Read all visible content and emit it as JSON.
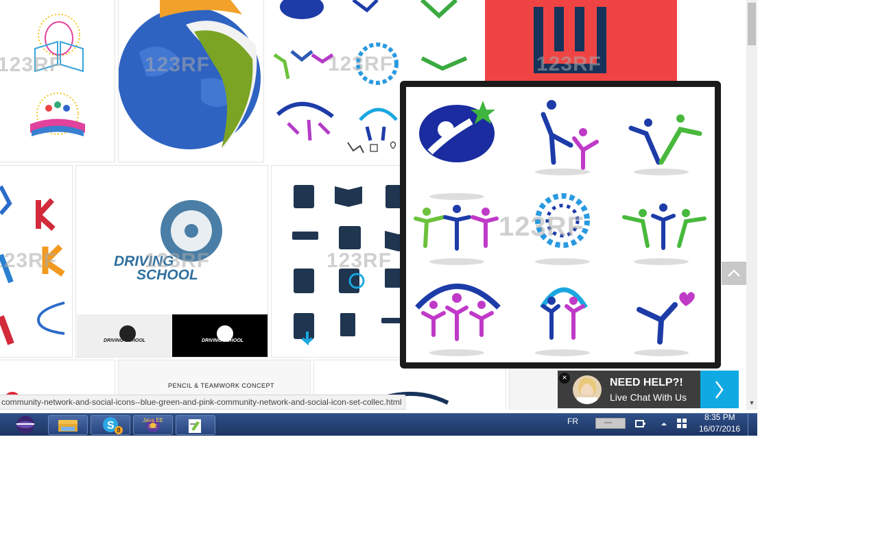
{
  "watermark": "123RF",
  "tiles": {
    "driving_school_title": "DRIVING",
    "driving_school_subtitle": "SCHOOL",
    "driving_school_small": "DRIVING SCHOOL",
    "pencil_concept": "PENCIL & TEAMWORK CONCEPT"
  },
  "popup": {
    "watermark": "123RF"
  },
  "chat": {
    "title": "NEED HELP?!",
    "subtitle": "Live Chat With Us",
    "close": "×"
  },
  "status_url": "community-network-and-social-icons--blue-green-and-pink-community-network-and-social-icon-set-collec.html",
  "taskbar": {
    "java_label": "Java EE IDE",
    "skype_badge": "8",
    "language": "FR",
    "battery_text": "---",
    "time": "8:35 PM",
    "date": "16/07/2016"
  },
  "colors": {
    "accent_red": "#f04444",
    "chat_blue": "#11a9e2",
    "taskbar": "#1c3462"
  }
}
